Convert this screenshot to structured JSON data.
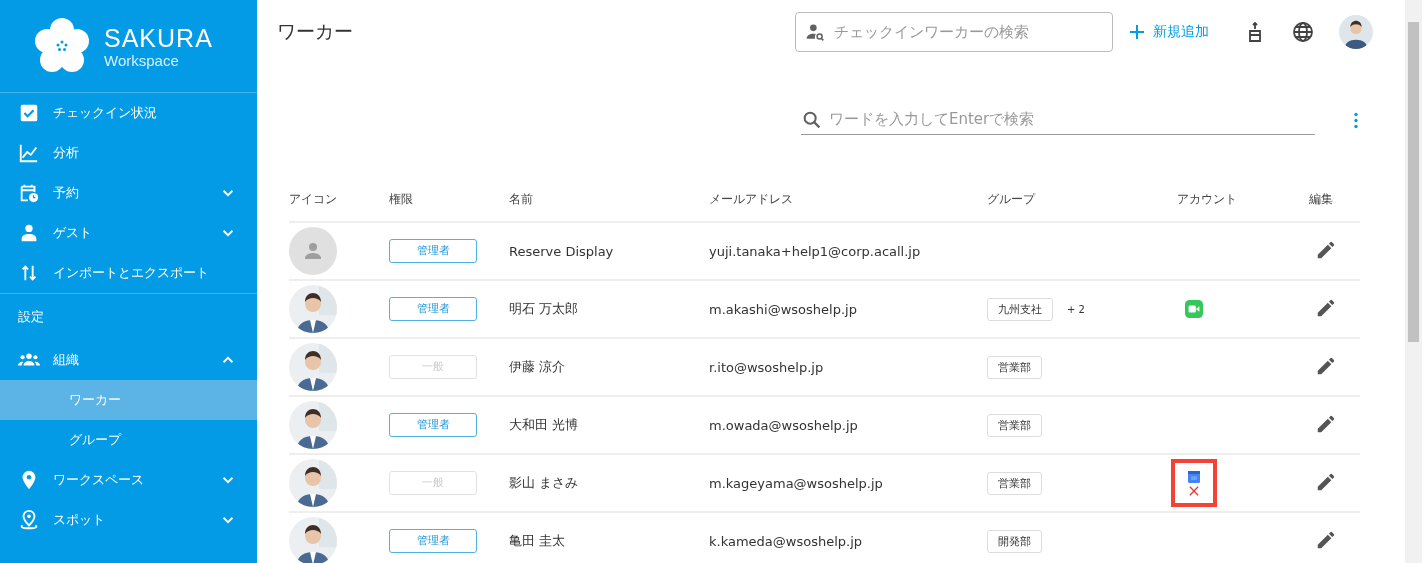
{
  "brand": {
    "name": "SAKURA",
    "subtitle": "Workspace"
  },
  "sidebar": {
    "items": [
      {
        "label": "チェックイン状況",
        "kind": "check",
        "selected": false
      },
      {
        "label": "分析",
        "kind": "chart",
        "selected": false
      },
      {
        "label": "予約",
        "kind": "calendar",
        "expanded": false,
        "selected": false
      },
      {
        "label": "ゲスト",
        "kind": "person",
        "expanded": false,
        "selected": false
      },
      {
        "label": "インポートとエクスポート",
        "kind": "arrows",
        "selected": false
      }
    ],
    "section_title": "設定",
    "settings_items": [
      {
        "label": "組織",
        "kind": "group",
        "expanded": true,
        "selected": false,
        "children": [
          {
            "label": "ワーカー",
            "selected": true
          },
          {
            "label": "グループ",
            "selected": false
          }
        ]
      },
      {
        "label": "ワークスペース",
        "kind": "pin",
        "expanded": false,
        "selected": false
      },
      {
        "label": "スポット",
        "kind": "spot",
        "expanded": false,
        "selected": false
      }
    ]
  },
  "header": {
    "title": "ワーカー",
    "checkin_search": {
      "placeholder": "チェックインワーカーの検索"
    },
    "add_button": "新規追加"
  },
  "search": {
    "placeholder": "ワードを入力してEnterで検索"
  },
  "table": {
    "columns": [
      "アイコン",
      "権限",
      "名前",
      "メールアドレス",
      "グループ",
      "アカウント",
      "編集"
    ],
    "rows": [
      {
        "avatar": {
          "kind": "placeholder"
        },
        "role": {
          "label": "管理者",
          "kind": "admin"
        },
        "name": "Reserve Display",
        "email": "yuji.tanaka+help1@corp.acall.jp",
        "groups": []
      },
      {
        "avatar": {
          "kind": "picture"
        },
        "role": {
          "label": "管理者",
          "kind": "admin"
        },
        "name": "明石 万太郎",
        "email": "m.akashi@wsoshelp.jp",
        "groups": [
          "九州支社"
        ],
        "more_groups": "+ 2",
        "account": {
          "kind": "video"
        }
      },
      {
        "avatar": {
          "kind": "picture"
        },
        "role": {
          "label": "一般",
          "kind": "general"
        },
        "name": "伊藤 涼介",
        "email": "r.ito@wsoshelp.jp",
        "groups": [
          "営業部"
        ]
      },
      {
        "avatar": {
          "kind": "picture"
        },
        "role": {
          "label": "管理者",
          "kind": "admin"
        },
        "name": "大和田 光博",
        "email": "m.owada@wsoshelp.jp",
        "groups": [
          "営業部"
        ]
      },
      {
        "avatar": {
          "kind": "picture"
        },
        "role": {
          "label": "一般",
          "kind": "general"
        },
        "name": "影山 まさみ",
        "email": "m.kageyama@wsoshelp.jp",
        "groups": [
          "営業部"
        ],
        "account": {
          "kind": "calendar_error"
        },
        "highlighted": true
      },
      {
        "avatar": {
          "kind": "picture"
        },
        "role": {
          "label": "管理者",
          "kind": "admin"
        },
        "name": "亀田 圭太",
        "email": "k.kameda@wsoshelp.jp",
        "groups": [
          "開発部"
        ]
      }
    ]
  }
}
